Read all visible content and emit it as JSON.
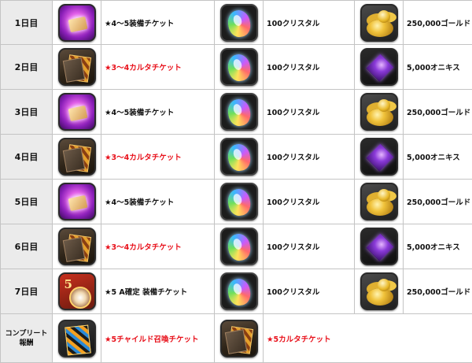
{
  "rows": [
    {
      "day": "1日目",
      "items": [
        {
          "icon": "equipment-ticket-icon",
          "label": "★4～5装備チケット",
          "red": false
        },
        {
          "icon": "crystal-icon",
          "label": "100クリスタル",
          "red": false
        },
        {
          "icon": "gold-coins-icon",
          "label": "250,000ゴールド",
          "red": false
        }
      ]
    },
    {
      "day": "2日目",
      "items": [
        {
          "icon": "carta-ticket-icon",
          "label": "★3～4カルタチケット",
          "red": true
        },
        {
          "icon": "crystal-icon",
          "label": "100クリスタル",
          "red": false
        },
        {
          "icon": "onyx-gem-icon",
          "label": "5,000オニキス",
          "red": false
        }
      ]
    },
    {
      "day": "3日目",
      "items": [
        {
          "icon": "equipment-ticket-icon",
          "label": "★4～5装備チケット",
          "red": false
        },
        {
          "icon": "crystal-icon",
          "label": "100クリスタル",
          "red": false
        },
        {
          "icon": "gold-coins-icon",
          "label": "250,000ゴールド",
          "red": false
        }
      ]
    },
    {
      "day": "4日目",
      "items": [
        {
          "icon": "carta-ticket-icon",
          "label": "★3～4カルタチケット",
          "red": true
        },
        {
          "icon": "crystal-icon",
          "label": "100クリスタル",
          "red": false
        },
        {
          "icon": "onyx-gem-icon",
          "label": "5,000オニキス",
          "red": false
        }
      ]
    },
    {
      "day": "5日目",
      "items": [
        {
          "icon": "equipment-ticket-icon",
          "label": "★4～5装備チケット",
          "red": false
        },
        {
          "icon": "crystal-icon",
          "label": "100クリスタル",
          "red": false
        },
        {
          "icon": "gold-coins-icon",
          "label": "250,000ゴールド",
          "red": false
        }
      ]
    },
    {
      "day": "6日目",
      "items": [
        {
          "icon": "carta-ticket-icon",
          "label": "★3～4カルタチケット",
          "red": true
        },
        {
          "icon": "crystal-icon",
          "label": "100クリスタル",
          "red": false
        },
        {
          "icon": "onyx-gem-icon",
          "label": "5,000オニキス",
          "red": false
        }
      ]
    },
    {
      "day": "7日目",
      "items": [
        {
          "icon": "a-confirmed-equipment-ticket-icon",
          "label": "★5 A確定 装備チケット",
          "red": false
        },
        {
          "icon": "crystal-icon",
          "label": "100クリスタル",
          "red": false
        },
        {
          "icon": "gold-coins-icon",
          "label": "250,000ゴールド",
          "red": false
        }
      ]
    }
  ],
  "complete": {
    "line1": "コンプリート",
    "line2": "報酬",
    "items": [
      {
        "icon": "child-summon-ticket-icon",
        "label": "★5チャイルド召喚チケット",
        "red": true
      },
      {
        "icon": "carta-ticket-icon",
        "label": "★5カルタチケット",
        "red": true
      }
    ]
  },
  "colors": {
    "highlight": "#e8101a",
    "text": "#111111",
    "header_bg": "#ebebeb",
    "border": "#c4c4c4"
  }
}
